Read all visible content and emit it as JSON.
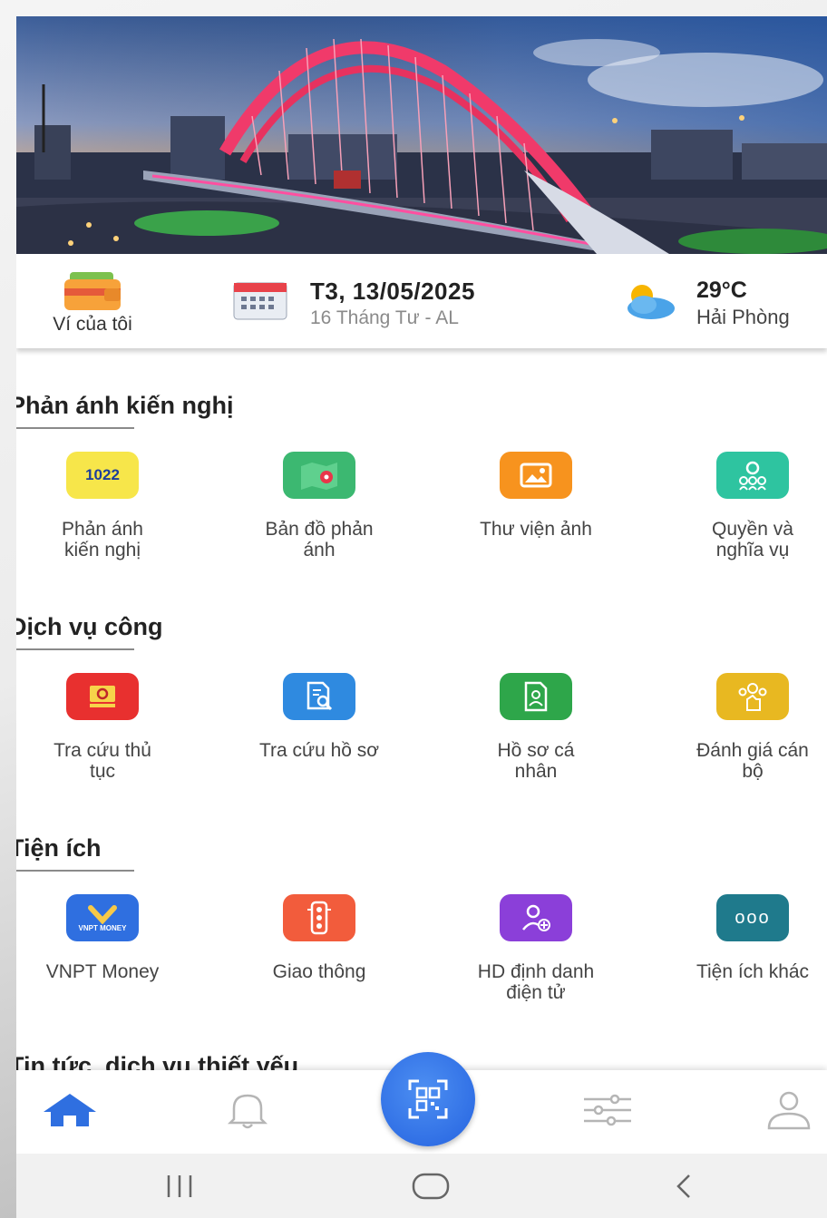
{
  "infobar": {
    "wallet_label": "Ví của tôi",
    "date_main": "T3, 13/05/2025",
    "date_lunar": "16 Tháng Tư - AL",
    "temperature": "29°C",
    "city": "Hải Phòng"
  },
  "sections": {
    "feedback": {
      "title": "Phản ánh kiến nghị",
      "items": [
        {
          "label_line1": "Phản ánh",
          "label_line2": "kiến nghị",
          "icon": "hotline-1022-icon",
          "icon_text": "1022",
          "color": "#f7e64a"
        },
        {
          "label_line1": "Bản đồ phản",
          "label_line2": "ánh",
          "icon": "map-pin-icon",
          "color": "#3cb871"
        },
        {
          "label_line1": "Thư viện ảnh",
          "label_line2": "",
          "icon": "image-gallery-icon",
          "color": "#f7931e"
        },
        {
          "label_line1": "Quyền và",
          "label_line2": "nghĩa vụ",
          "icon": "rights-duties-icon",
          "color": "#2ec4a0"
        }
      ]
    },
    "public_services": {
      "title": "Dịch vụ công",
      "items": [
        {
          "label_line1": "Tra cứu thủ",
          "label_line2": "tục",
          "icon": "procedure-search-icon",
          "color": "#e8302f"
        },
        {
          "label_line1": "Tra cứu hồ sơ",
          "label_line2": "",
          "icon": "document-search-icon",
          "color": "#2f8ae0"
        },
        {
          "label_line1": "Hồ sơ cá",
          "label_line2": "nhân",
          "icon": "personal-profile-icon",
          "color": "#2ea64a"
        },
        {
          "label_line1": "Đánh giá cán",
          "label_line2": "bộ",
          "icon": "officer-rating-icon",
          "color": "#e8b821"
        }
      ]
    },
    "utilities": {
      "title": "Tiện ích",
      "items": [
        {
          "label_line1": "VNPT Money",
          "label_line2": "",
          "icon": "vnpt-money-icon",
          "icon_text": "VNPT MONEY",
          "color": "#2f6fe0"
        },
        {
          "label_line1": "Giao thông",
          "label_line2": "",
          "icon": "traffic-light-icon",
          "color": "#f25c3c"
        },
        {
          "label_line1": "HD định danh",
          "label_line2": "điện tử",
          "icon": "e-identity-icon",
          "color": "#8b3fd9"
        },
        {
          "label_line1": "Tiện ích khác",
          "label_line2": "",
          "icon": "more-icon",
          "icon_text": "ooo",
          "color": "#1f7a8c"
        }
      ]
    },
    "news": {
      "title": "Tin tức, dịch vụ thiết yếu"
    }
  },
  "bottom_nav": [
    "home-icon",
    "bell-icon",
    "qr-scan-icon",
    "settings-sliders-icon",
    "user-icon"
  ],
  "colors": {
    "accent": "#2f6fe0",
    "nav_active": "#2f6fe0",
    "nav_inactive": "#b5b5b5"
  }
}
